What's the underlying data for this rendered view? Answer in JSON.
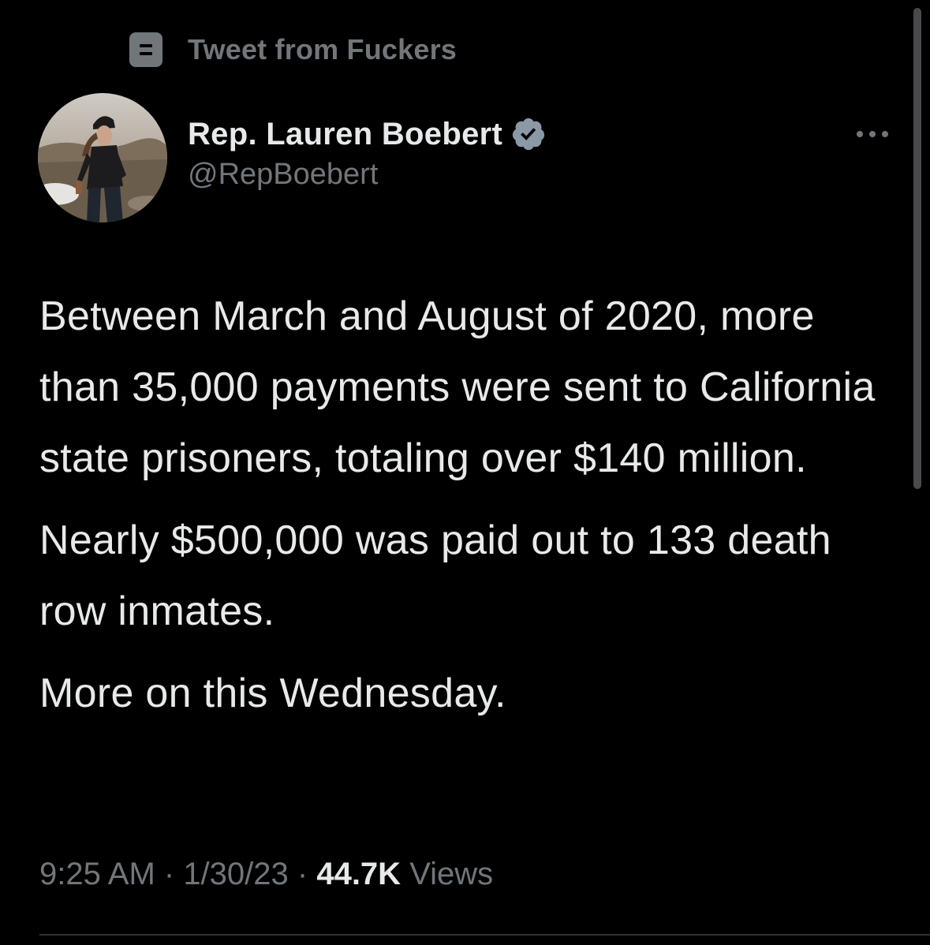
{
  "context": {
    "icon": "list-icon",
    "label": "Tweet from Fuckers"
  },
  "author": {
    "display_name": "Rep. Lauren Boebert",
    "handle": "@RepBoebert",
    "verified_icon": "verified-badge-icon",
    "verified_color": "#71767b"
  },
  "more_icon": "more-options-icon",
  "tweet": {
    "paragraphs": [
      "Between March and August of 2020, more than 35,000 payments were sent to California state prisoners, totaling over $140 million.",
      "Nearly $500,000 was paid out to 133 death row inmates.",
      "More on this Wednesday."
    ]
  },
  "meta": {
    "time": "9:25 AM",
    "separator": " · ",
    "date": "1/30/23",
    "views_count": "44.7K",
    "views_label": " Views"
  },
  "colors": {
    "background": "#000000",
    "text": "#e7e9ea",
    "secondary": "#71767b"
  }
}
